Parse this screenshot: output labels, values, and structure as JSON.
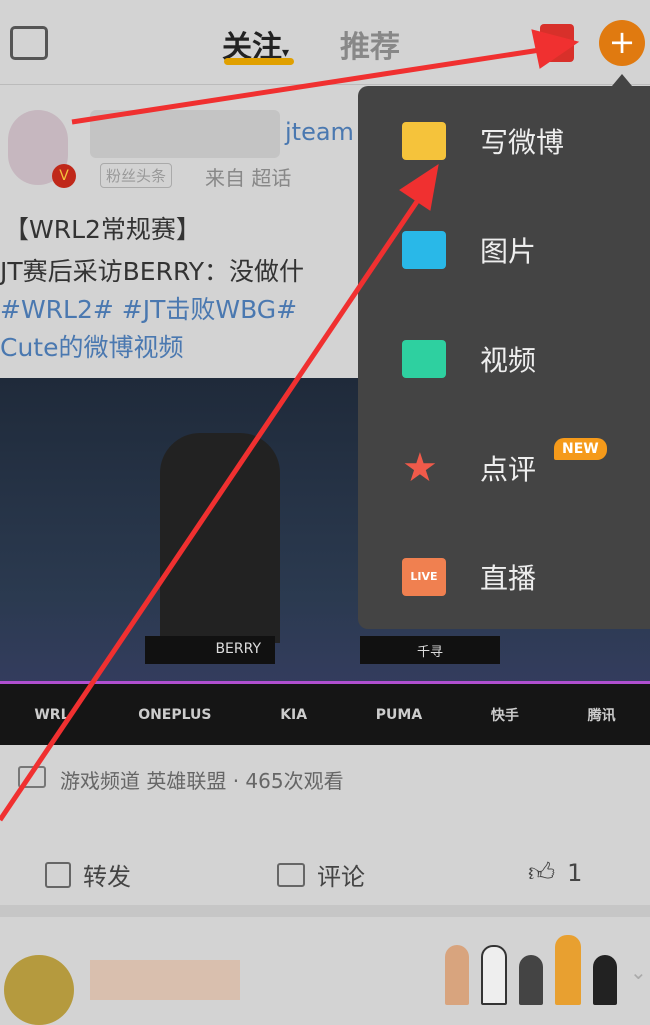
{
  "header": {
    "tabs": [
      {
        "label": "关注",
        "active": true
      },
      {
        "label": "推荐"
      }
    ],
    "accent": "#e8a400",
    "plus_color": "#e07a10"
  },
  "post": {
    "handle_suffix": "jteam",
    "badge": "粉丝头条",
    "source": "来自 超话",
    "title": "【WRL2常规赛】",
    "line2": "JT赛后采访BERRY：没做什",
    "tags": "#WRL2# #JT击败WBG#",
    "line4": "Cute的微博视频",
    "video": {
      "player_name": "BERRY",
      "player2": "千寻",
      "sponsors": [
        "WRL",
        "ONEPLUS",
        "KIA",
        "PUMA",
        "快手",
        "腾讯"
      ]
    },
    "meta": "游戏频道 英雄联盟 · 465次观看",
    "actions": {
      "repost": "转发",
      "comment": "评论",
      "like_count": "1"
    }
  },
  "menu": {
    "items": [
      {
        "label": "写微博",
        "icon": "write-icon",
        "color": "#f5c33b"
      },
      {
        "label": "图片",
        "icon": "image-icon",
        "color": "#29b8e8"
      },
      {
        "label": "视频",
        "icon": "video-icon",
        "color": "#2ed0a0"
      },
      {
        "label": "点评",
        "icon": "review-star-icon",
        "color": "#f05a4a",
        "badge": "NEW"
      },
      {
        "label": "直播",
        "icon": "live-icon",
        "color": "#f08050",
        "icon_text": "LIVE"
      }
    ]
  }
}
